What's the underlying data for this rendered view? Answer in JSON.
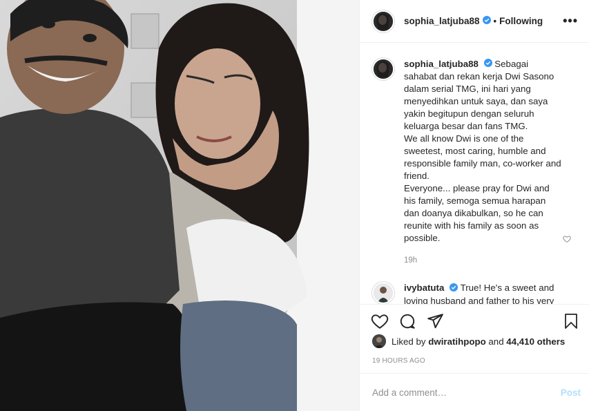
{
  "header": {
    "username": "sophia_latjuba88",
    "separator": "•",
    "follow_status": "Following",
    "more_label": "•••"
  },
  "caption": {
    "username": "sophia_latjuba88",
    "text": "Sebagai sahabat dan rekan kerja Dwi Sasono dalam serial TMG, ini hari yang menyedihkan untuk saya, dan saya yakin begitupun dengan seluruh keluarga besar dan fans TMG.\nWe all know Dwi is one of the sweetest, most caring, humble and responsible family man, co-worker and friend.\nEveryone... please pray for Dwi and his family, semoga semua harapan dan doanya dikabulkan, so he can reunite with his family as soon as possible.",
    "time": "19h"
  },
  "comment": {
    "username": "ivybatuta",
    "text": "True! He's a sweet and loving husband and father to his very family"
  },
  "actions": {
    "like_icon": "heart-outline-icon",
    "comment_icon": "comment-bubble-icon",
    "share_icon": "paper-plane-icon",
    "save_icon": "bookmark-icon"
  },
  "likes": {
    "prefix": "Liked by",
    "user": "dwiratihpopo",
    "joiner": "and",
    "others": "44,410 others"
  },
  "posted_ago": "19 HOURS AGO",
  "add_comment": {
    "placeholder": "Add a comment…",
    "post_label": "Post"
  },
  "colors": {
    "verified": "#3897f0",
    "post_disabled": "#b2dffc",
    "muted": "#8e8e8e"
  }
}
